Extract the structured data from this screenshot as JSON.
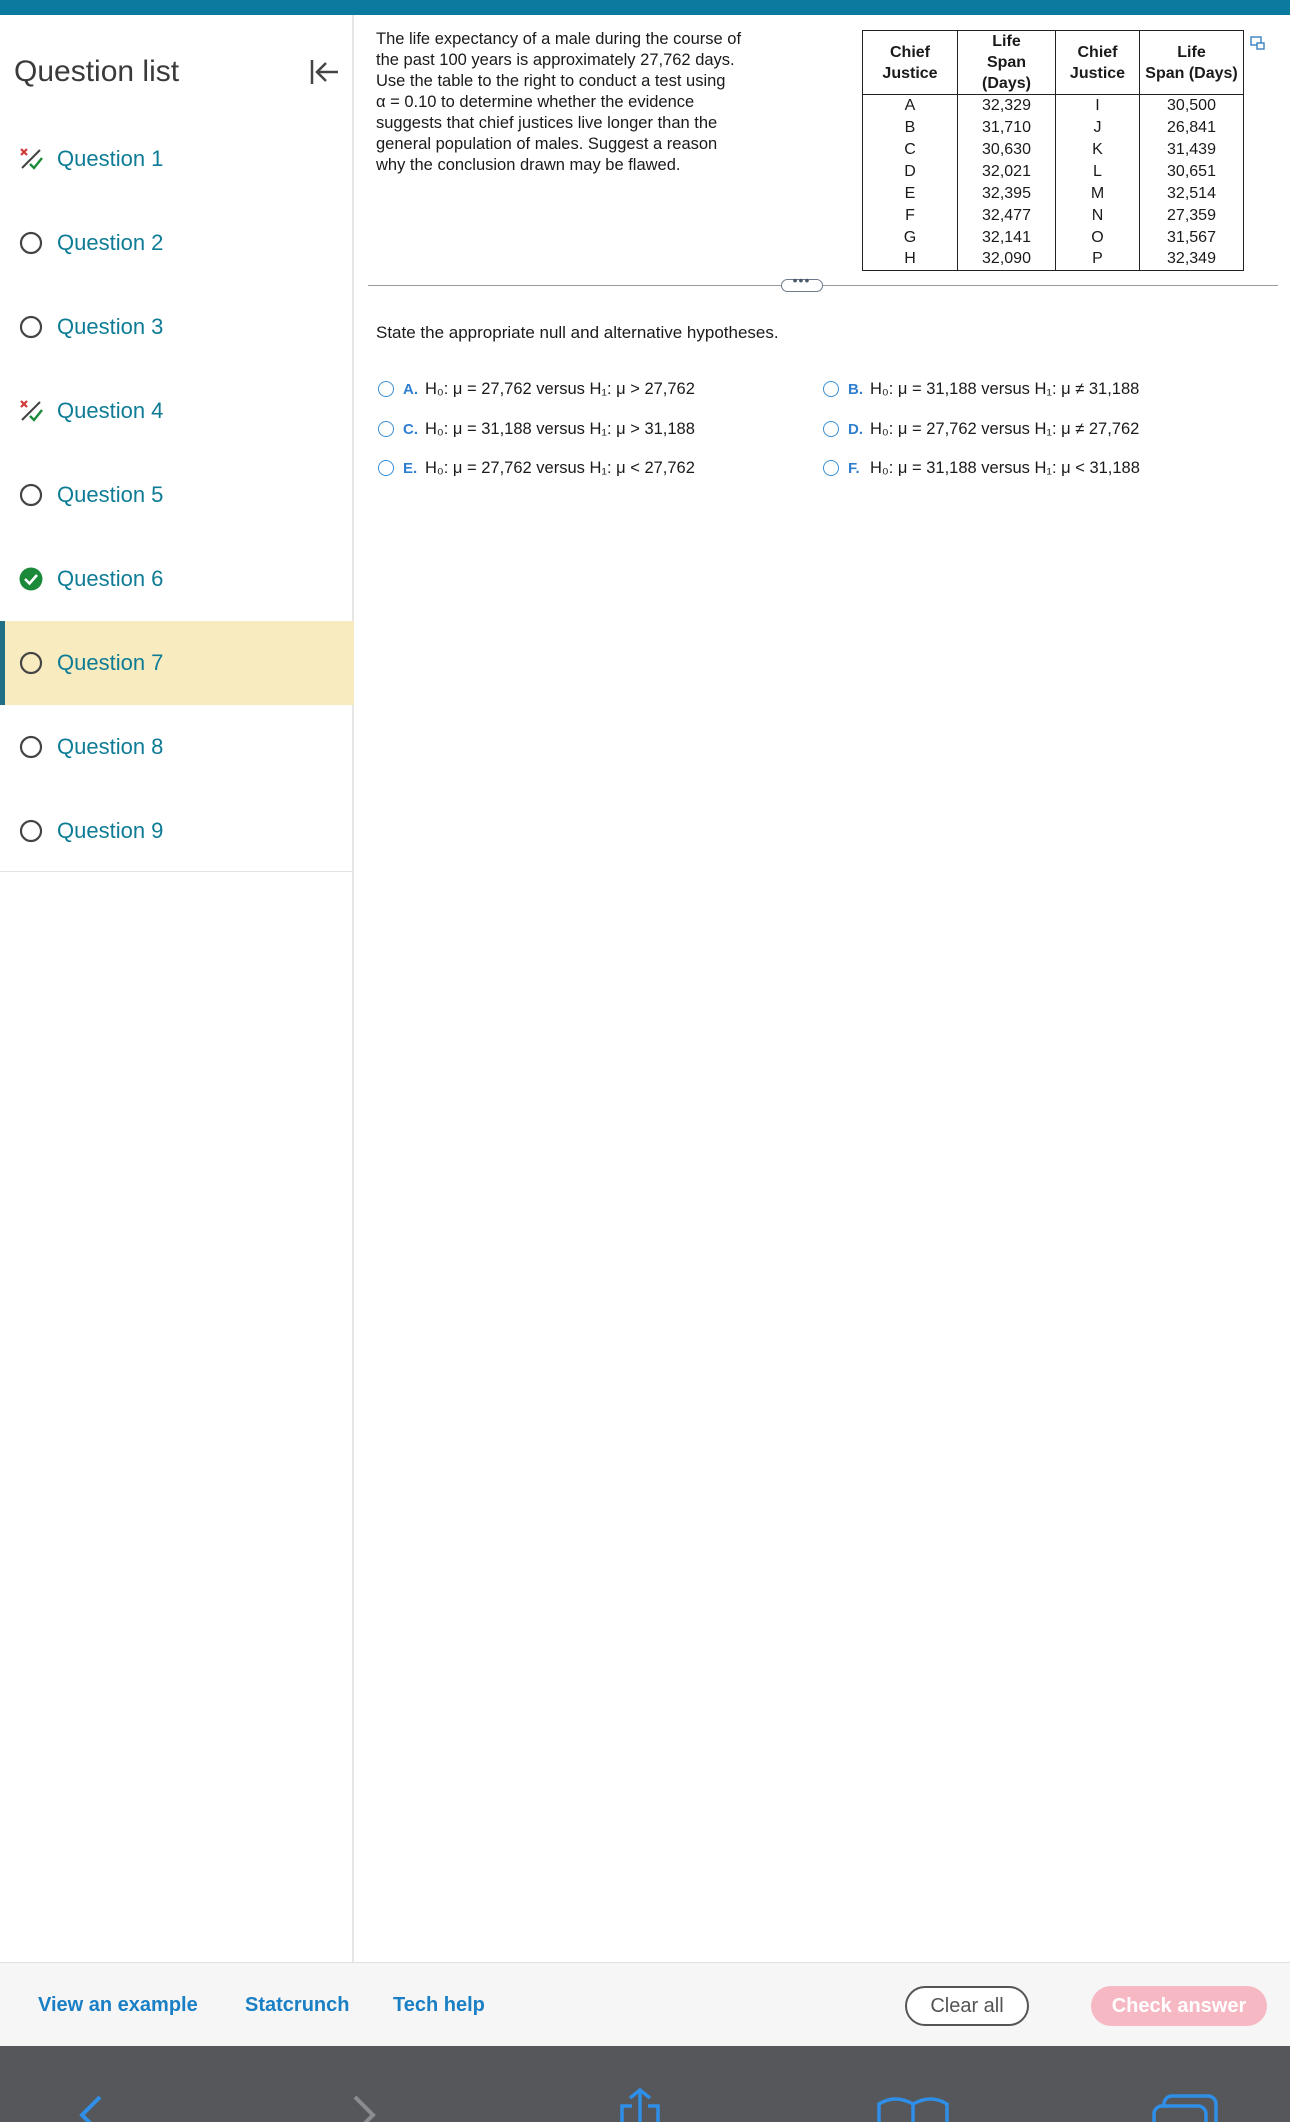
{
  "sidebar": {
    "title": "Question list",
    "questions": [
      {
        "label": "Question 1",
        "status": "partial"
      },
      {
        "label": "Question 2",
        "status": "unanswered"
      },
      {
        "label": "Question 3",
        "status": "unanswered"
      },
      {
        "label": "Question 4",
        "status": "partial"
      },
      {
        "label": "Question 5",
        "status": "unanswered"
      },
      {
        "label": "Question 6",
        "status": "correct"
      },
      {
        "label": "Question 7",
        "status": "current"
      },
      {
        "label": "Question 8",
        "status": "unanswered"
      },
      {
        "label": "Question 9",
        "status": "unanswered"
      }
    ]
  },
  "problem": {
    "lines": [
      "The life expectancy of a male during the course of",
      "the past 100 years is approximately 27,762 days.",
      "Use the table to the right to conduct a test using",
      "α = 0.10 to determine whether the evidence",
      "suggests that chief justices live longer than the",
      "general population of males. Suggest a reason",
      "why the conclusion drawn may be flawed."
    ]
  },
  "table": {
    "headers": [
      [
        "Chief",
        "Justice"
      ],
      [
        "Life",
        "Span (Days)"
      ],
      [
        "Chief",
        "Justice"
      ],
      [
        "Life",
        "Span (Days)"
      ]
    ],
    "rows": [
      [
        "A",
        "32,329",
        "I",
        "30,500"
      ],
      [
        "B",
        "31,710",
        "J",
        "26,841"
      ],
      [
        "C",
        "30,630",
        "K",
        "31,439"
      ],
      [
        "D",
        "32,021",
        "L",
        "30,651"
      ],
      [
        "E",
        "32,395",
        "M",
        "32,514"
      ],
      [
        "F",
        "32,477",
        "N",
        "27,359"
      ],
      [
        "G",
        "32,141",
        "O",
        "31,567"
      ],
      [
        "H",
        "32,090",
        "P",
        "32,349"
      ]
    ]
  },
  "prompt": "State the appropriate null and alternative hypotheses.",
  "options": [
    {
      "letter": "A.",
      "text": "H₀: μ = 27,762 versus H₁: μ > 27,762"
    },
    {
      "letter": "B.",
      "text": "H₀: μ = 31,188 versus H₁: μ ≠ 31,188"
    },
    {
      "letter": "C.",
      "text": "H₀: μ = 31,188 versus H₁: μ > 31,188"
    },
    {
      "letter": "D.",
      "text": "H₀: μ = 27,762 versus H₁: μ ≠ 27,762"
    },
    {
      "letter": "E.",
      "text": "H₀: μ = 27,762 versus H₁: μ < 27,762"
    },
    {
      "letter": "F.",
      "text": "H₀: μ = 31,188 versus H₁: μ < 31,188"
    }
  ],
  "footer": {
    "view_example": "View an example",
    "statcrunch": "Statcrunch",
    "tech_help": "Tech help",
    "clear_all": "Clear all",
    "check_answer": "Check answer"
  },
  "colors": {
    "accent": "#0e7c95",
    "current_highlight": "#f9ebc0",
    "link": "#1a7fc4",
    "check_button": "#f6b8c3",
    "correct": "#1a8a3a",
    "wrong_mark": "#d23a3a"
  },
  "icons": {
    "collapse": "collapse-left-icon",
    "partial": "partial-credit-icon",
    "unanswered": "empty-circle-icon",
    "correct": "check-circle-icon",
    "popout": "popout-icon",
    "expand": "ellipsis-icon"
  }
}
